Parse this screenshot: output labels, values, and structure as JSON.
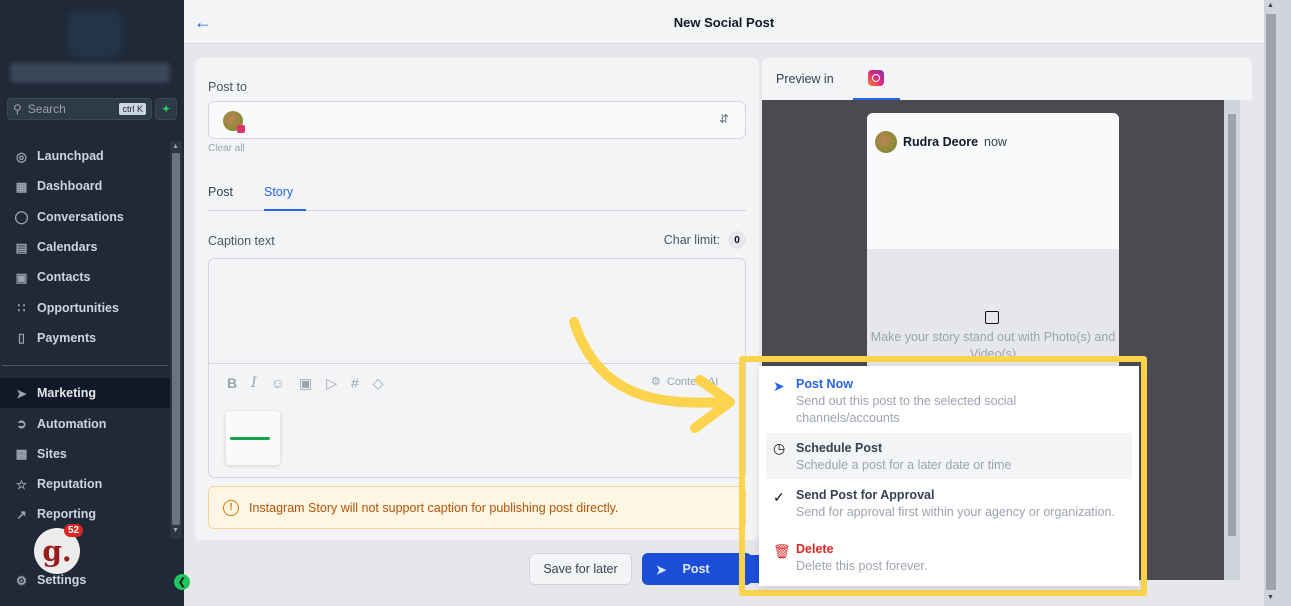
{
  "sidebar": {
    "search": {
      "placeholder": "Search",
      "shortcut": "ctrl K"
    },
    "items": [
      {
        "label": "Launchpad",
        "icon": "launchpad-icon"
      },
      {
        "label": "Dashboard",
        "icon": "dashboard-icon"
      },
      {
        "label": "Conversations",
        "icon": "chat-icon"
      },
      {
        "label": "Calendars",
        "icon": "calendar-icon"
      },
      {
        "label": "Contacts",
        "icon": "contacts-icon"
      },
      {
        "label": "Opportunities",
        "icon": "opportunities-icon"
      },
      {
        "label": "Payments",
        "icon": "payments-icon"
      }
    ],
    "items2": [
      {
        "label": "Marketing",
        "icon": "send-icon"
      },
      {
        "label": "Automation",
        "icon": "automation-icon"
      },
      {
        "label": "Sites",
        "icon": "sites-icon"
      },
      {
        "label": "Reputation",
        "icon": "star-icon"
      },
      {
        "label": "Reporting",
        "icon": "chart-icon"
      }
    ],
    "settings": "Settings",
    "avatar_letter": "g.",
    "notif_count": "52"
  },
  "header": {
    "title": "New Social Post"
  },
  "composer": {
    "post_to_label": "Post to",
    "clear_all": "Clear all",
    "tabs": [
      "Post",
      "Story"
    ],
    "active_tab": "Story",
    "caption_label": "Caption text",
    "char_limit_label": "Char limit:",
    "char_count": "0",
    "content_ai": "Content AI",
    "warning": "Instagram Story will not support caption for publishing post directly."
  },
  "actions": {
    "save_later": "Save for later",
    "post": "Post"
  },
  "preview": {
    "label": "Preview in",
    "username": "Rudra Deore",
    "time": "now",
    "media_msg": "Make your story stand out with Photo(s) and Video(s)"
  },
  "dropdown": [
    {
      "title": "Post Now",
      "desc": "Send out this post to the selected social channels/accounts",
      "icon": "send-icon",
      "style": "primary"
    },
    {
      "title": "Schedule Post",
      "desc": "Schedule a post for a later date or time",
      "icon": "clock-icon",
      "style": "hover"
    },
    {
      "title": "Send Post for Approval",
      "desc": "Send for approval first within your agency or organization.",
      "icon": "check-badge-icon",
      "style": "normal"
    },
    {
      "title": "Delete",
      "desc": "Delete this post forever.",
      "icon": "trash-icon",
      "style": "danger"
    }
  ],
  "colors": {
    "accent": "#2563eb",
    "highlight": "#fcd34d",
    "sidebar_bg": "#1f2937",
    "danger": "#dc2626"
  }
}
